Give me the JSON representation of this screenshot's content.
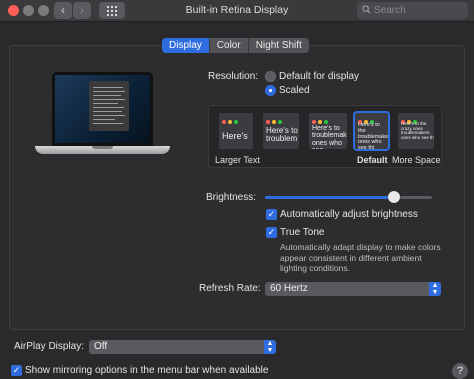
{
  "window": {
    "title": "Built-in Retina Display"
  },
  "search": {
    "placeholder": "Search"
  },
  "tabs": [
    {
      "label": "Display",
      "active": true
    },
    {
      "label": "Color",
      "active": false
    },
    {
      "label": "Night Shift",
      "active": false
    }
  ],
  "resolution": {
    "label": "Resolution:",
    "options": [
      {
        "label": "Default for display",
        "selected": false
      },
      {
        "label": "Scaled",
        "selected": true
      }
    ],
    "scales": [
      {
        "preview": "Here's",
        "label": "Larger Text",
        "selected": false
      },
      {
        "preview": "Here's to troublem",
        "label": "",
        "selected": false
      },
      {
        "preview": "Here's to troublemak ones who see",
        "label": "",
        "selected": false
      },
      {
        "preview": "Here's to the troublemakers ones who see thi",
        "label": "Default",
        "selected": true
      },
      {
        "preview": "Here's to the crazy ones troublemakers ones who see thi",
        "label": "More Space",
        "selected": false
      }
    ]
  },
  "brightness": {
    "label": "Brightness:",
    "value": 0.77
  },
  "auto_brightness": {
    "label": "Automatically adjust brightness",
    "checked": true
  },
  "true_tone": {
    "label": "True Tone",
    "checked": true,
    "description": "Automatically adapt display to make colors appear consistent in different ambient lighting conditions."
  },
  "refresh_rate": {
    "label": "Refresh Rate:",
    "value": "60 Hertz"
  },
  "airplay": {
    "label": "AirPlay Display:",
    "value": "Off"
  },
  "mirroring": {
    "label": "Show mirroring options in the menu bar when available",
    "checked": true
  },
  "help": {
    "label": "?"
  },
  "colors": {
    "accent": "#2f6ce0",
    "close": "#ff5f57",
    "yellow": "#febc2e",
    "green": "#28c840"
  }
}
